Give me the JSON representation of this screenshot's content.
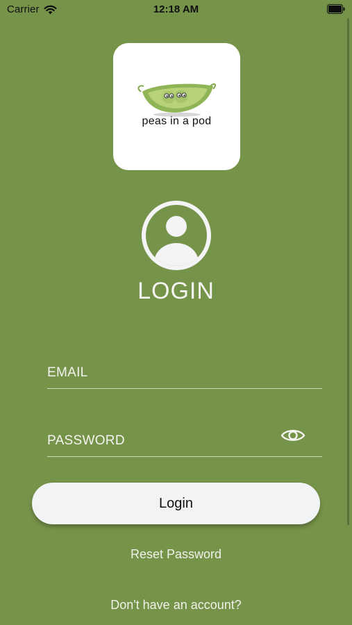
{
  "status_bar": {
    "carrier": "Carrier",
    "time": "12:18 AM",
    "icons": [
      "wifi-icon",
      "battery-icon"
    ]
  },
  "logo": {
    "text": "peas in a pod",
    "icon": "peapod-logo-icon"
  },
  "profile": {
    "icon": "user-profile-icon"
  },
  "title": "LOGIN",
  "form": {
    "email_placeholder": "EMAIL",
    "email_value": "",
    "password_placeholder": "PASSWORD",
    "password_value": "",
    "toggle_icon": "eye-icon"
  },
  "actions": {
    "login_label": "Login",
    "reset_label": "Reset Password",
    "signup_label": "Don't have an account?"
  },
  "colors": {
    "background": "#76934a",
    "button": "#f2f3f5",
    "text_light": "#f4f4f0",
    "pea_green": "#a6c46a"
  }
}
